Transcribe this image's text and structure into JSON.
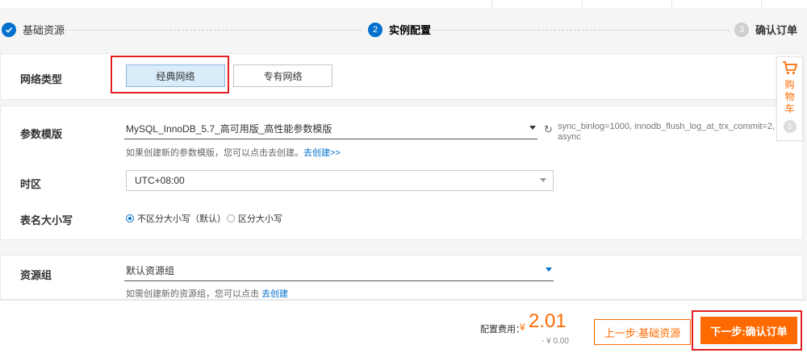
{
  "steps": [
    {
      "label": "基础资源",
      "number": "",
      "status": "done"
    },
    {
      "label": "实例配置",
      "number": "2",
      "status": "active"
    },
    {
      "label": "确认订单",
      "number": "3",
      "status": "todo"
    }
  ],
  "network": {
    "label": "网络类型",
    "options": [
      "经典网络",
      "专有网络"
    ],
    "selected": "经典网络"
  },
  "params": {
    "template_label": "参数模版",
    "template_value": "MySQL_InnoDB_5.7_高可用版_高性能参数模版",
    "template_hint": "如果创建新的参数模版，您可以点击去创建。",
    "template_hint_link": "去创建>>",
    "template_tip": "sync_binlog=1000, innodb_flush_log_at_trx_commit=2, async",
    "timezone_label": "时区",
    "timezone_value": "UTC+08:00",
    "case_label": "表名大小写",
    "case_options": [
      "不区分大小写（默认）",
      "区分大小写"
    ],
    "case_selected": "不区分大小写（默认）"
  },
  "resource": {
    "label": "资源组",
    "value": "默认资源组",
    "hint": "如需创建新的资源组，您可以点击",
    "hint_link": "去创建"
  },
  "cart": {
    "chars": [
      "购",
      "物",
      "车"
    ],
    "count": "0"
  },
  "footer": {
    "fee_label": "配置费用：",
    "currency": "¥",
    "amount": "2.01",
    "discount": "- ¥ 0.00",
    "prev_button": "上一步:基础资源",
    "next_button": "下一步:确认订单"
  },
  "colors": {
    "accent": "#ff6a00",
    "primary": "#0070cc",
    "highlight_box": "#e21e1e"
  }
}
